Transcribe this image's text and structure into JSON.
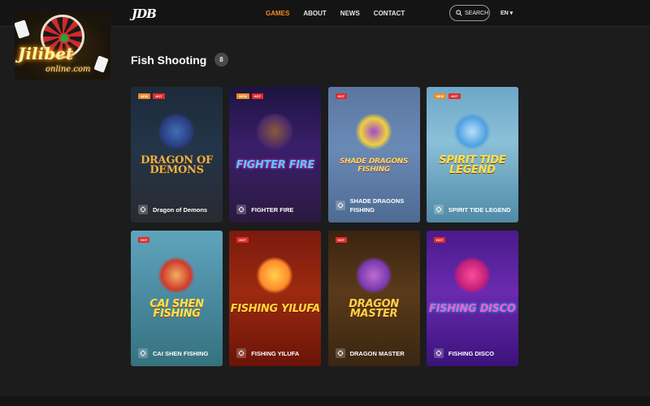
{
  "header": {
    "brand": "JDB",
    "nav": [
      "GAMES",
      "ABOUT",
      "NEWS",
      "CONTACT"
    ],
    "active_nav": "GAMES",
    "search_label": "SEARCH",
    "language": "EN",
    "accent_color": "#f08a24"
  },
  "watermark": {
    "title": "Jilibet",
    "subtitle": "online.com"
  },
  "section": {
    "title": "Fish Shooting",
    "count": "8"
  },
  "games": [
    {
      "title": "Dragon of Demons",
      "logo": "DRAGON OF DEMONS",
      "badges": [
        "NEW",
        "HOT"
      ]
    },
    {
      "title": "FIGHTER FIRE",
      "logo": "FIGHTER FIRE",
      "badges": [
        "NEW",
        "HOT"
      ]
    },
    {
      "title": "SHADE DRAGONS FISHING",
      "logo": "SHADE DRAGONS FISHING",
      "badges": [
        "HOT"
      ]
    },
    {
      "title": "SPIRIT TIDE LEGEND",
      "logo": "SPIRIT TIDE LEGEND",
      "badges": [
        "NEW",
        "HOT"
      ]
    },
    {
      "title": "CAI SHEN FISHING",
      "logo": "CAI SHEN FISHING",
      "badges": [
        "HOT"
      ]
    },
    {
      "title": "FISHING YILUFA",
      "logo": "FISHING YILUFA",
      "badges": [
        "HOT"
      ]
    },
    {
      "title": "DRAGON MASTER",
      "logo": "DRAGON MASTER",
      "badges": [
        "HOT"
      ]
    },
    {
      "title": "FISHING DISCO",
      "logo": "FISHING DISCO",
      "badges": [
        "HOT"
      ]
    }
  ],
  "icons": {
    "search": "search-icon",
    "tile": "crosshair-icon",
    "language": "chevron-down-icon"
  }
}
